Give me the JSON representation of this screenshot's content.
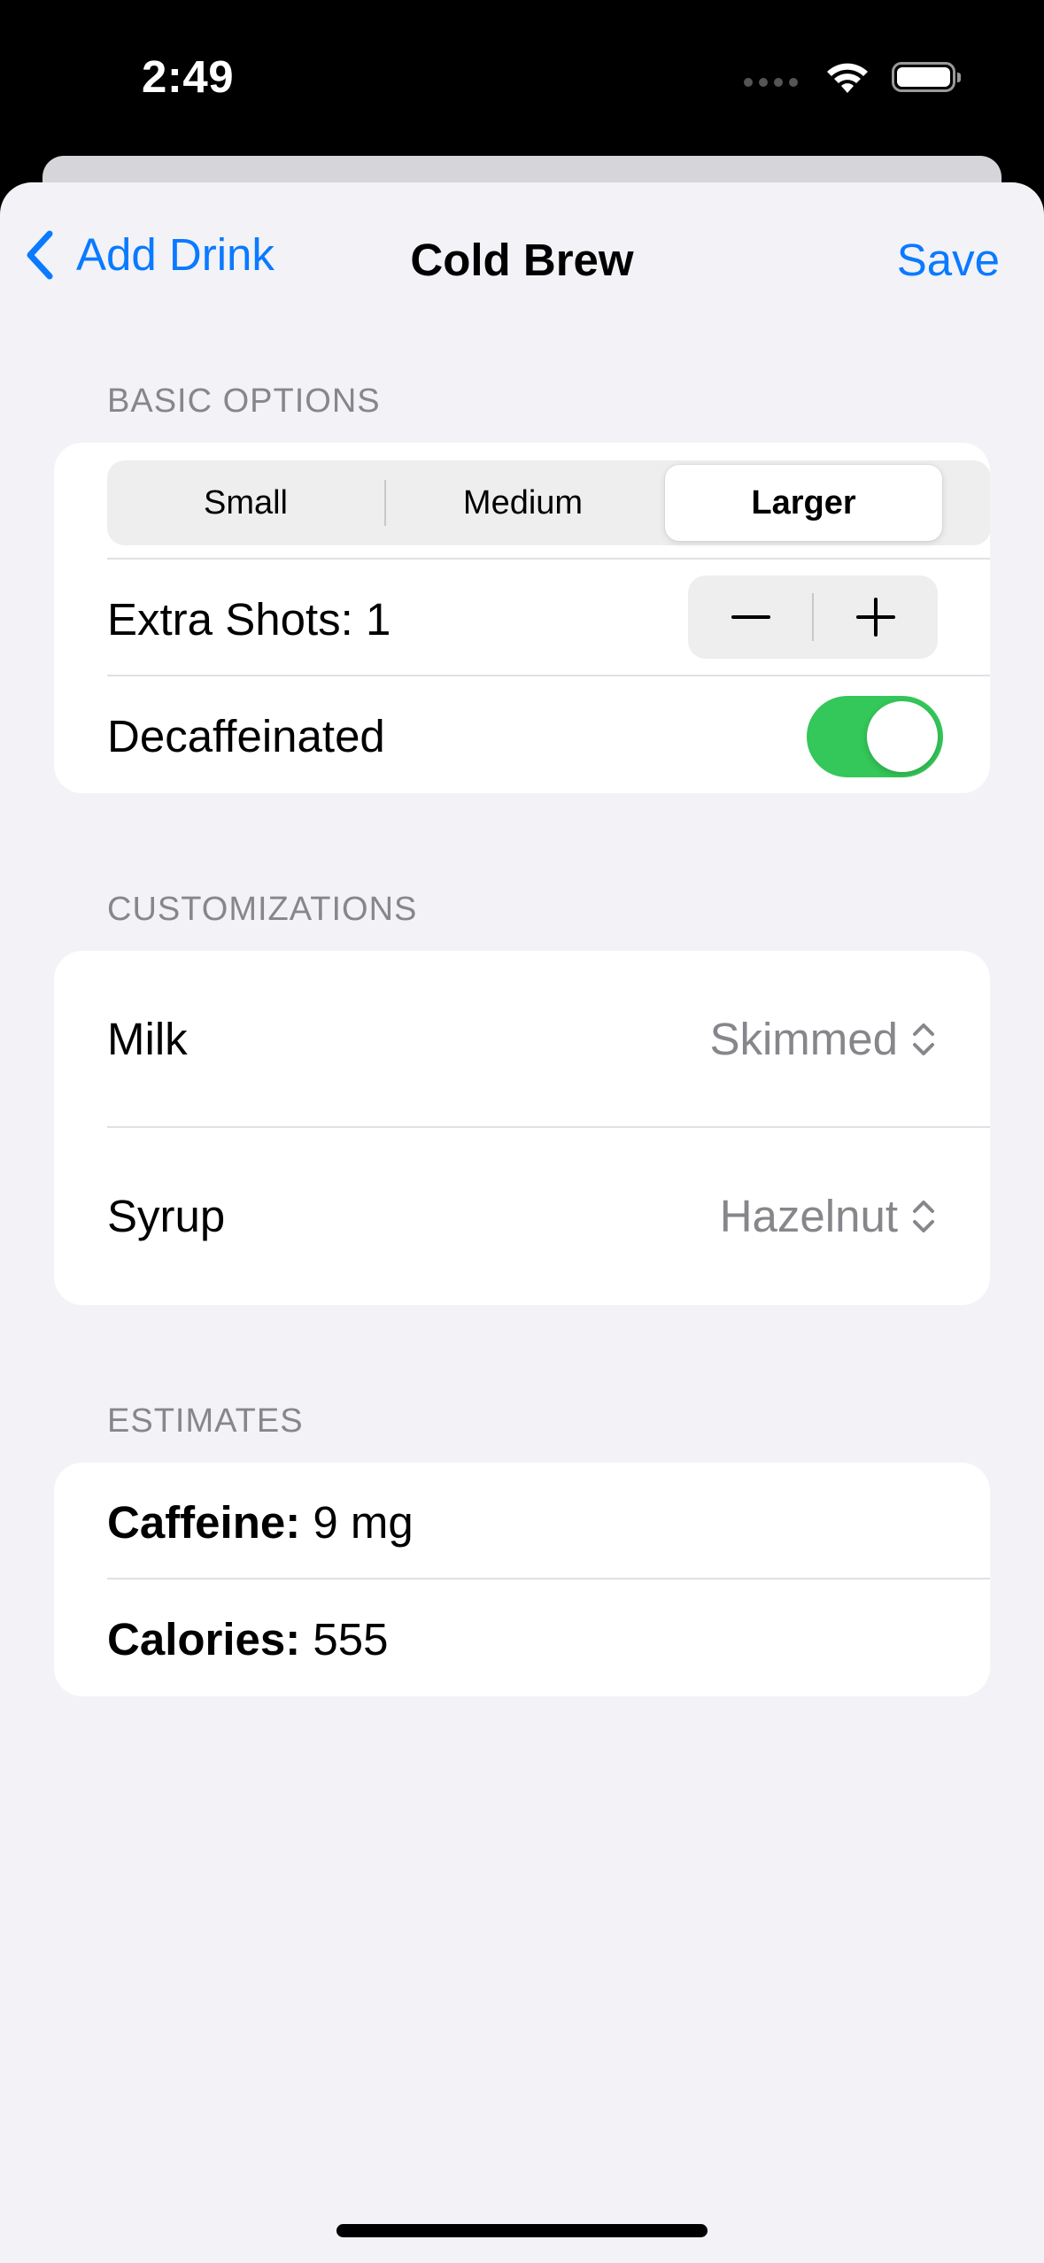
{
  "status_bar": {
    "time": "2:49"
  },
  "nav": {
    "back_label": "Add Drink",
    "title": "Cold Brew",
    "save_label": "Save"
  },
  "basic_options": {
    "header": "BASIC OPTIONS",
    "sizes": [
      "Small",
      "Medium",
      "Larger"
    ],
    "selected_size": "Larger",
    "extra_shots_label": "Extra Shots: 1",
    "decaf_label": "Decaffeinated",
    "decaf_on": true
  },
  "customizations": {
    "header": "CUSTOMIZATIONS",
    "milk_label": "Milk",
    "milk_value": "Skimmed",
    "syrup_label": "Syrup",
    "syrup_value": "Hazelnut"
  },
  "estimates": {
    "header": "ESTIMATES",
    "caffeine_label": "Caffeine:",
    "caffeine_value": "9 mg",
    "calories_label": "Calories:",
    "calories_value": "555"
  },
  "colors": {
    "accent": "#0a7aff",
    "toggle_on": "#34c759",
    "background": "#f2f2f7",
    "secondary_text": "#86868b"
  },
  "icons": {
    "back": "chevron-left-icon",
    "wifi": "wifi-icon",
    "battery": "battery-icon",
    "minus": "minus-icon",
    "plus": "plus-icon",
    "updown": "chevron-up-down-icon"
  }
}
